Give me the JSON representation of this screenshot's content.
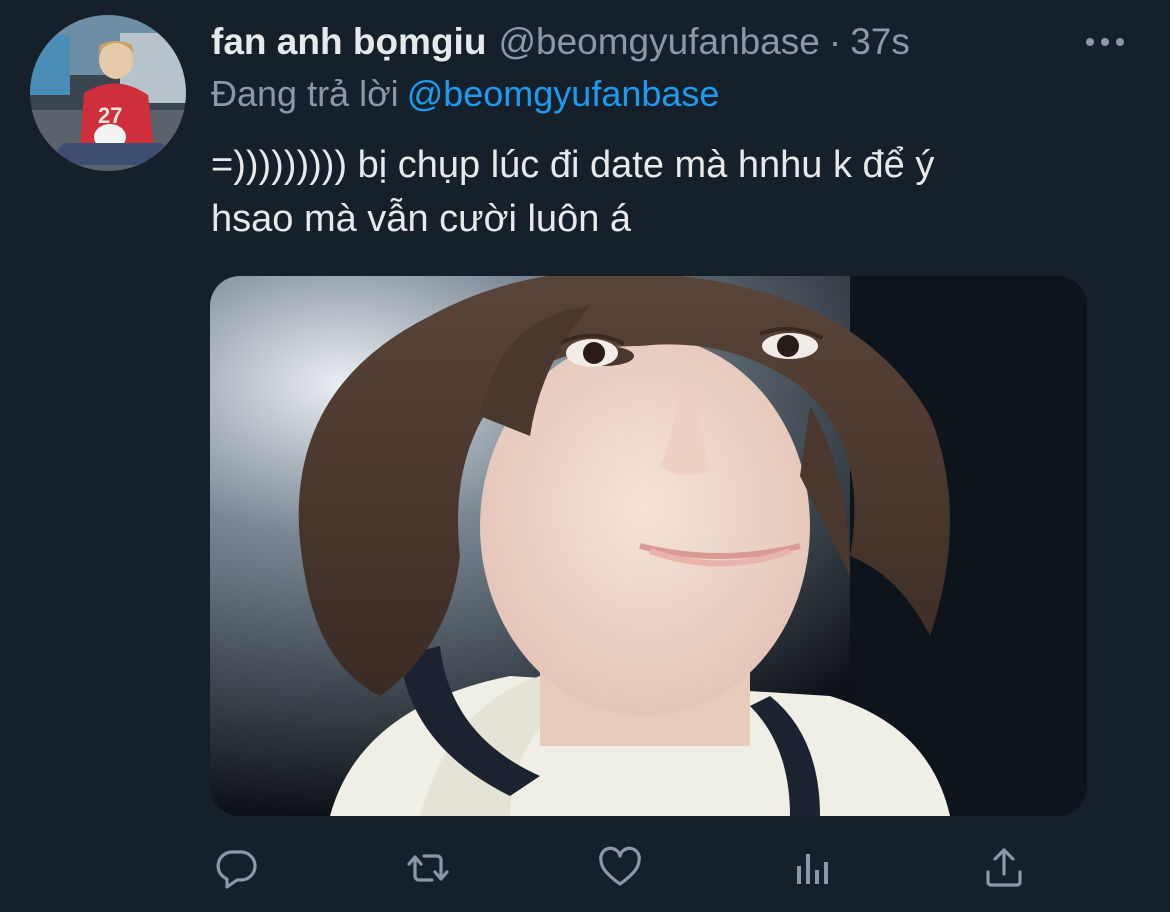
{
  "tweet": {
    "author": {
      "display_name": "fan anh bọmgiu",
      "handle": "@beomgyufanbase"
    },
    "separator": "·",
    "time_ago": "37s",
    "reply_prefix": "Đang trả lời",
    "reply_target": "@beomgyufanbase",
    "text_line1": "=))))))))) bị chụp lúc đi date mà hnhu k để ý",
    "text_line2": "hsao mà vẫn cười luôn á"
  },
  "icons": {
    "more": "more-horizontal-icon",
    "reply": "reply-icon",
    "retweet": "retweet-icon",
    "like": "like-icon",
    "analytics": "analytics-icon",
    "share": "share-icon"
  },
  "colors": {
    "background": "#15202b",
    "text_primary": "#e7e9ea",
    "text_secondary": "#8b98a5",
    "link": "#1d9bf0"
  }
}
